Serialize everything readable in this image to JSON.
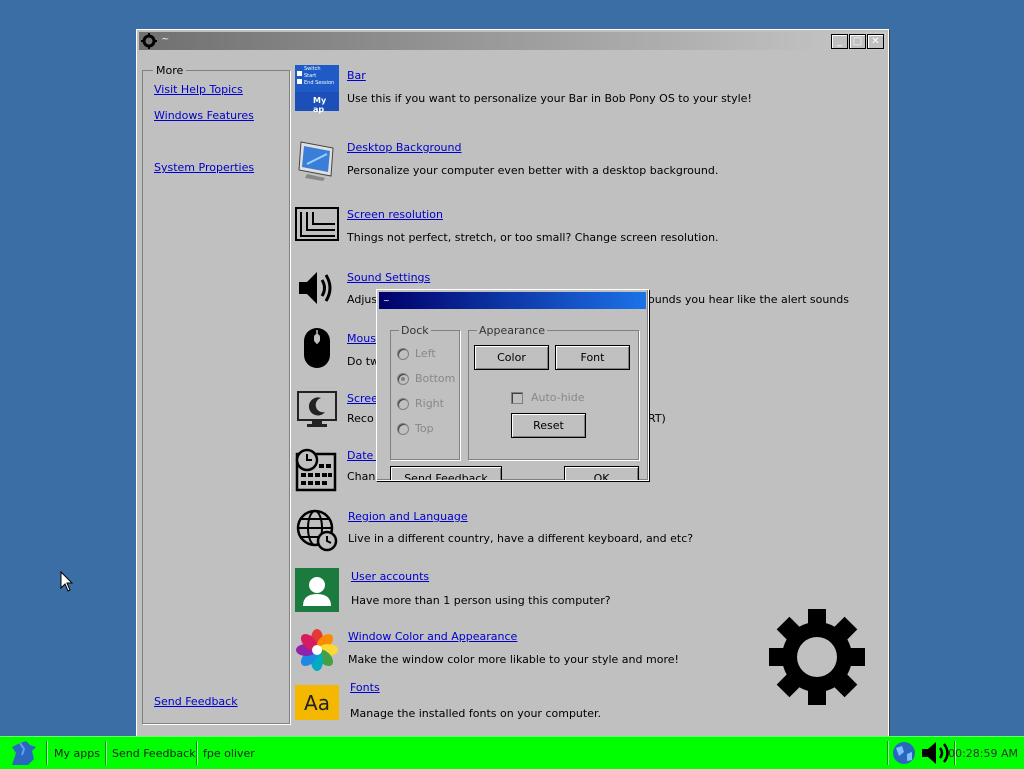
{
  "main_window": {
    "title_icon": "gear-icon",
    "controls": {
      "minimize": "_",
      "maximize": "□",
      "close": "✕"
    }
  },
  "sidebar": {
    "legend": "More",
    "links": [
      "Visit Help Topics",
      "Windows Features",
      "System Properties"
    ],
    "feedback": "Send Feedback"
  },
  "items": [
    {
      "title": "Bar",
      "desc": "Use this if you want to personalize your Bar in Bob Pony OS to your style!",
      "icon": "bar-icon"
    },
    {
      "title": "Desktop Background",
      "desc": "Personalize your computer even better with a desktop background.",
      "icon": "monitor-icon"
    },
    {
      "title": "Screen resolution",
      "desc": "Things not perfect, stretch, or too small? Change screen resolution.",
      "icon": "resolution-icon"
    },
    {
      "title": "Sound Settings",
      "desc": "Adjus",
      "desc_tail": "ounds you hear like the alert sounds",
      "icon": "speaker-icon"
    },
    {
      "title": "Mouse",
      "desc": "Do tw",
      "icon": "mouse-icon"
    },
    {
      "title": "Scree",
      "desc": "Reco",
      "desc_tail": "RT)",
      "icon": "screensaver-icon"
    },
    {
      "title": "Date a",
      "desc": "Chang",
      "icon": "calendar-icon"
    },
    {
      "title": "Region and Language",
      "desc": "Live in a different country, have a different keyboard, and etc?",
      "icon": "globe-clock-icon"
    },
    {
      "title": "User accounts",
      "desc": "Have more than 1 person using this computer?",
      "icon": "user-icon"
    },
    {
      "title": "Window Color and Appearance",
      "desc": "Make the window color more likable to your style and more!",
      "icon": "color-wheel-icon"
    },
    {
      "title": "Fonts",
      "desc": "Manage the installed fonts on your computer.",
      "icon": "fonts-icon",
      "icon_text": "Aa"
    }
  ],
  "bar_icon_text": [
    "Switch",
    "Start",
    "End Session",
    "My ap"
  ],
  "dialog": {
    "dock_legend": "Dock",
    "dock_options": [
      "Left",
      "Bottom",
      "Right",
      "Top"
    ],
    "dock_selected": "Bottom",
    "appearance_legend": "Appearance",
    "color_button": "Color",
    "font_button": "Font",
    "autohide_label": "Auto-hide",
    "reset_button": "Reset",
    "send_feedback_button": "Send Feedback",
    "ok_button": "OK"
  },
  "taskbar": {
    "items": [
      "My apps",
      "Send Feedback",
      "fpe oliver"
    ],
    "clock": "00:28:59 AM",
    "start_icon": "pony-icon",
    "tray_icons": [
      "globe-icon",
      "volume-icon"
    ]
  },
  "colors": {
    "desktop": "#3a6ea5",
    "taskbar": "#00ff00",
    "window": "#c0c0c0",
    "dialog_title": "#00006a"
  }
}
